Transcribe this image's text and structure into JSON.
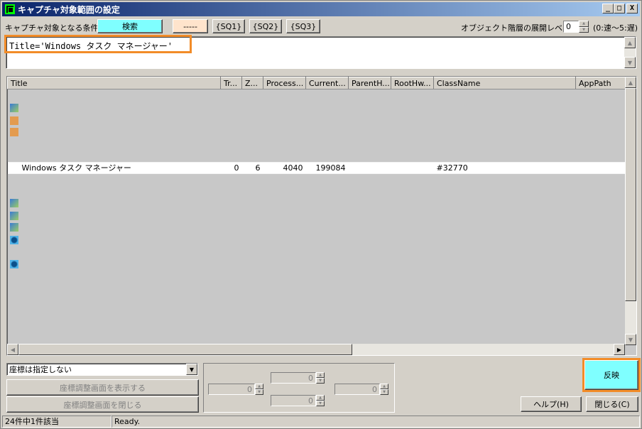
{
  "window": {
    "title": "キャプチャ対象範囲の設定",
    "min": "_",
    "max": "□",
    "close": "X"
  },
  "toolbar": {
    "cond_label": "キャプチャ対象となる条件:",
    "search_label": "検索",
    "dash_label": "-----",
    "sq1": "{SQ1}",
    "sq2": "{SQ2}",
    "sq3": "{SQ3}",
    "level_label": "オブジェクト階層の展開レベル:",
    "level_value": "0",
    "level_hint": "(0:速～5:遅)"
  },
  "condition": {
    "text": "Title='Windows タスク マネージャー'"
  },
  "table": {
    "columns": [
      "Title",
      "Tr...",
      "Z...",
      "Process...",
      "Current...",
      "ParentH...",
      "RootHw...",
      "ClassName",
      "AppPath"
    ],
    "selected_row": {
      "title": "Windows タスク マネージャー",
      "tr": "0",
      "z": "6",
      "process": "4040",
      "current": "199084",
      "parent": "",
      "root": "",
      "classname": "#32770",
      "apppath": ""
    }
  },
  "coords": {
    "mode": "座標は指定しない",
    "show_btn": "座標調整画面を表示する",
    "close_btn": "座標調整画面を閉じる",
    "top": "0",
    "left": "0",
    "right": "0",
    "bottom": "0"
  },
  "actions": {
    "apply": "反映",
    "help": "ヘルプ(H)",
    "close": "閉じる(C)"
  },
  "status": {
    "count": "24件中1件該当",
    "state": "Ready."
  },
  "colors": {
    "search_bg": "#7fffff",
    "dash_bg": "#ffe4cc",
    "highlight": "#f28c28"
  }
}
